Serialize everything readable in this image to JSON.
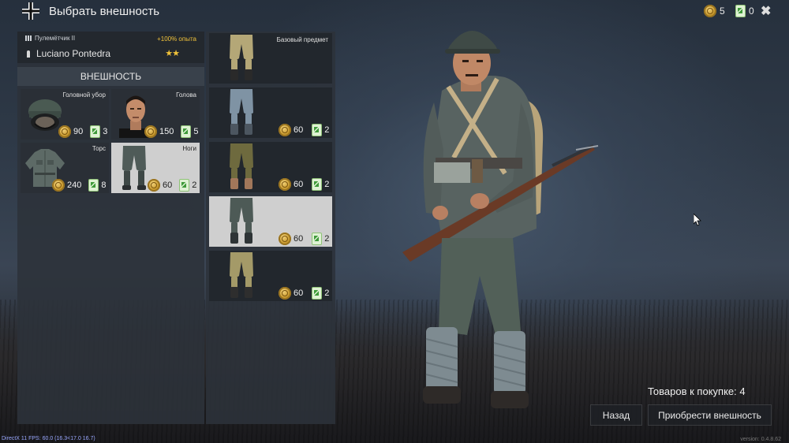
{
  "header": {
    "title": "Выбрать внешность",
    "coins": "5",
    "tickets": "0"
  },
  "soldier": {
    "class": "Пулемётчик II",
    "xp_bonus": "+100% опыта",
    "name": "Luciano Pontedra",
    "stars": "★★"
  },
  "appearance": {
    "section_label": "ВНЕШНОСТЬ",
    "categories": [
      {
        "label": "Головной убор",
        "coins": "90",
        "tickets": "3"
      },
      {
        "label": "Голова",
        "coins": "150",
        "tickets": "5"
      },
      {
        "label": "Торс",
        "coins": "240",
        "tickets": "8"
      },
      {
        "label": "Ноги",
        "coins": "60",
        "tickets": "2"
      }
    ]
  },
  "items": [
    {
      "label": "Базовый предмет",
      "coins": "",
      "tickets": "",
      "pants_color": "#b4a777",
      "boot_color": "#2a2a2a"
    },
    {
      "label": "",
      "coins": "60",
      "tickets": "2",
      "pants_color": "#7f93a4",
      "boot_color": "#4c5660"
    },
    {
      "label": "",
      "coins": "60",
      "tickets": "2",
      "pants_color": "#6e6a3e",
      "boot_color": "#a2775a"
    },
    {
      "label": "",
      "coins": "60",
      "tickets": "2",
      "pants_color": "#4d5a56",
      "boot_color": "#2e3436"
    },
    {
      "label": "",
      "coins": "60",
      "tickets": "2",
      "pants_color": "#a49a68",
      "boot_color": "#2e2e2e"
    }
  ],
  "footer": {
    "to_buy": "Товаров к покупке: 4",
    "back_label": "Назад",
    "buy_label": "Приобрести внешность",
    "fps": "DirectX 11 FPS: 60.0 (16.3<17.0 16.7)",
    "version": "version: 0.4.8.62"
  },
  "colors": {
    "accent_gold": "#f0c23a",
    "selected_bg": "#cfcfcf"
  }
}
